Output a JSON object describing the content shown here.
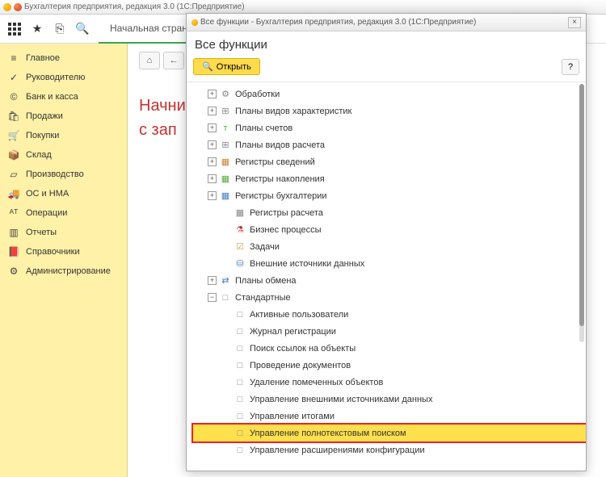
{
  "app": {
    "title": "Бухгалтерия предприятия, редакция 3.0 (1С:Предприятие)",
    "start_tab": "Начальная страница",
    "start_text_line1": "Начни",
    "start_text_line2": "с зап"
  },
  "sidebar": {
    "items": [
      {
        "icon": "menu",
        "label": "Главное"
      },
      {
        "icon": "chart",
        "label": "Руководителю"
      },
      {
        "icon": "bank",
        "label": "Банк и касса"
      },
      {
        "icon": "bag",
        "label": "Продажи"
      },
      {
        "icon": "cart",
        "label": "Покупки"
      },
      {
        "icon": "box",
        "label": "Склад"
      },
      {
        "icon": "factory",
        "label": "Производство"
      },
      {
        "icon": "truck",
        "label": "ОС и НМА"
      },
      {
        "icon": "ops",
        "label": "Операции"
      },
      {
        "icon": "report",
        "label": "Отчеты"
      },
      {
        "icon": "book",
        "label": "Справочники"
      },
      {
        "icon": "gear",
        "label": "Администрирование"
      }
    ]
  },
  "modal": {
    "title": "Все функции - Бухгалтерия предприятия, редакция 3.0 (1С:Предприятие)",
    "header": "Все функции",
    "open_label": "Открыть",
    "help": "?",
    "close": "×",
    "tree": [
      {
        "indent": 1,
        "exp": "+",
        "icon": "⚙",
        "label": "Обработки"
      },
      {
        "indent": 1,
        "exp": "+",
        "icon": "⊞",
        "label": "Планы видов характеристик"
      },
      {
        "indent": 1,
        "exp": "+",
        "icon": "т",
        "iconColor": "#5aa746",
        "label": "Планы счетов"
      },
      {
        "indent": 1,
        "exp": "+",
        "icon": "⊞",
        "label": "Планы видов расчета"
      },
      {
        "indent": 1,
        "exp": "+",
        "icon": "▦",
        "iconColor": "#d07f3a",
        "label": "Регистры сведений"
      },
      {
        "indent": 1,
        "exp": "+",
        "icon": "▦",
        "iconColor": "#5aa746",
        "label": "Регистры накопления"
      },
      {
        "indent": 1,
        "exp": "+",
        "icon": "▦",
        "iconColor": "#467fbf",
        "label": "Регистры бухгалтерии"
      },
      {
        "indent": 2,
        "exp": "",
        "icon": "▦",
        "label": "Регистры расчета"
      },
      {
        "indent": 2,
        "exp": "",
        "icon": "⚗",
        "iconColor": "#c83232",
        "label": "Бизнес процессы"
      },
      {
        "indent": 2,
        "exp": "",
        "icon": "☑",
        "iconColor": "#d9a14a",
        "label": "Задачи"
      },
      {
        "indent": 2,
        "exp": "",
        "icon": "⛁",
        "iconColor": "#467fbf",
        "label": "Внешние источники данных"
      },
      {
        "indent": 1,
        "exp": "+",
        "icon": "⇄",
        "iconColor": "#467fbf",
        "label": "Планы обмена"
      },
      {
        "indent": 1,
        "exp": "−",
        "icon": "□",
        "label": "Стандартные"
      },
      {
        "indent": 2,
        "exp": "",
        "icon": "□",
        "label": "Активные пользователи"
      },
      {
        "indent": 2,
        "exp": "",
        "icon": "□",
        "label": "Журнал регистрации"
      },
      {
        "indent": 2,
        "exp": "",
        "icon": "□",
        "label": "Поиск ссылок на объекты"
      },
      {
        "indent": 2,
        "exp": "",
        "icon": "□",
        "label": "Проведение документов"
      },
      {
        "indent": 2,
        "exp": "",
        "icon": "□",
        "label": "Удаление помеченных объектов"
      },
      {
        "indent": 2,
        "exp": "",
        "icon": "□",
        "label": "Управление внешними источниками данных"
      },
      {
        "indent": 2,
        "exp": "",
        "icon": "□",
        "label": "Управление итогами"
      },
      {
        "indent": 2,
        "exp": "",
        "icon": "□",
        "label": "Управление полнотекстовым поиском",
        "hl": true
      },
      {
        "indent": 2,
        "exp": "",
        "icon": "□",
        "label": "Управление расширениями конфигурации"
      }
    ]
  },
  "icons": {
    "menu": "≡",
    "chart": "✓",
    "bank": "©",
    "bag": "🛍",
    "cart": "🛒",
    "box": "📦",
    "factory": "▱",
    "truck": "🚚",
    "ops": "ᴬᵀ",
    "report": "▥",
    "book": "📕",
    "gear": "⚙",
    "home": "⌂",
    "back": "←",
    "fwd": "→",
    "star": "★",
    "clip": "⎘",
    "search": "🔍"
  }
}
